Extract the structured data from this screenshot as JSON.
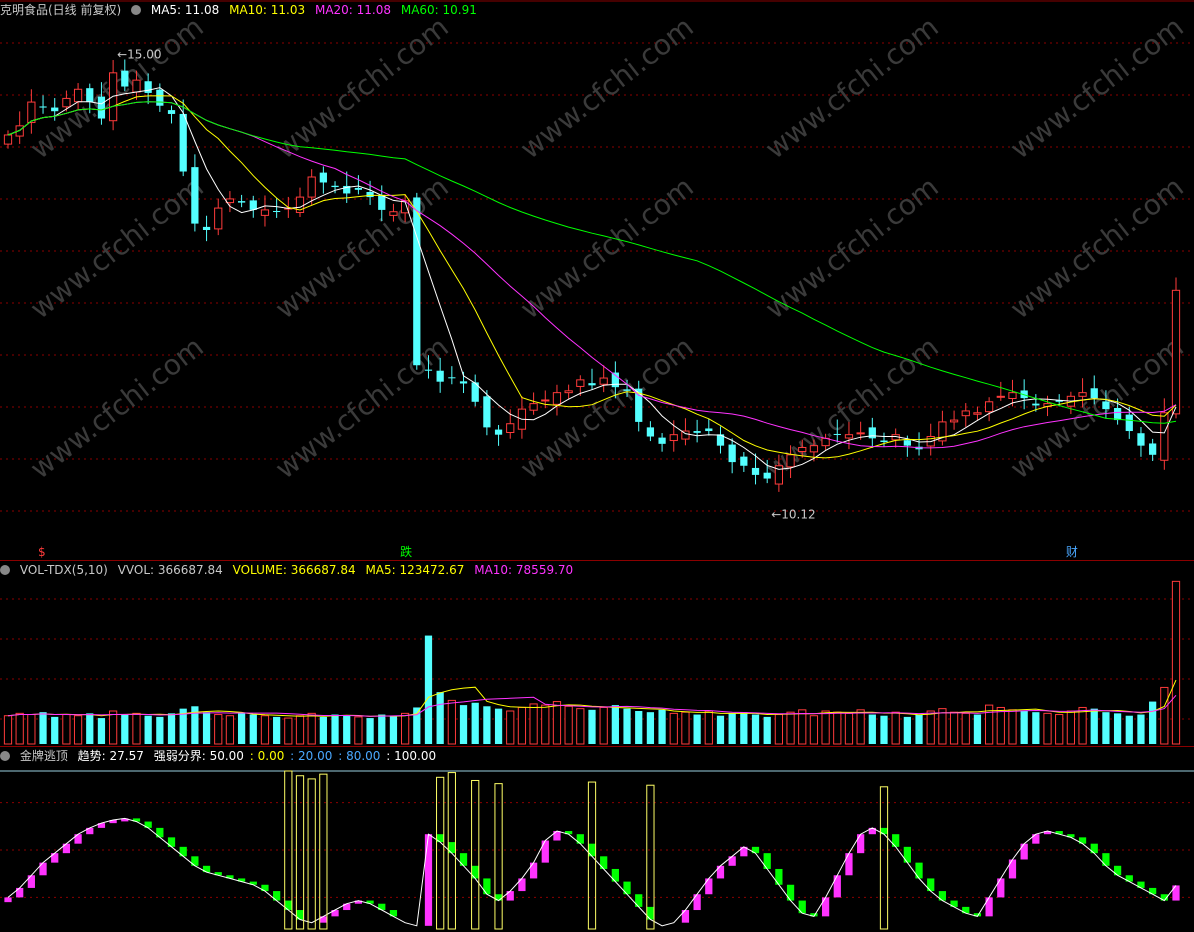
{
  "header": {
    "title": "克明食品(日线 前复权)",
    "ma_items": [
      {
        "label": "MA5: 11.08",
        "color": "#ffffff"
      },
      {
        "label": "MA10: 11.03",
        "color": "#ffff00"
      },
      {
        "label": "MA20: 11.08",
        "color": "#ff33ff"
      },
      {
        "label": "MA60: 10.91",
        "color": "#00ff00"
      }
    ]
  },
  "vol_header": {
    "title": "VOL-TDX(5,10)",
    "items": [
      {
        "label": "VVOL: 366687.84",
        "color": "#c8c8c8"
      },
      {
        "label": "VOLUME: 366687.84",
        "color": "#ffff00"
      },
      {
        "label": "MA5: 123472.67",
        "color": "#ffff00"
      },
      {
        "label": "MA10: 78559.70",
        "color": "#ff33ff"
      }
    ]
  },
  "ind_header": {
    "title": "金牌逃顶",
    "items": [
      {
        "label": "趋势: 27.57",
        "color": "#ffffff"
      },
      {
        "label": "强弱分界: 50.00",
        "color": "#ffffff"
      },
      {
        "label": ": 0.00",
        "color": "#ffff00"
      },
      {
        "label": ": 20.00",
        "color": "#4aa8ff"
      },
      {
        "label": ": 80.00",
        "color": "#4aa8ff"
      },
      {
        "label": ": 100.00",
        "color": "#ffffff"
      }
    ]
  },
  "watermark": "www.cfchi.com",
  "colors": {
    "up": "#ff3b3b",
    "down": "#54ffff",
    "ma5": "#ffffff",
    "ma10": "#ffff00",
    "ma20": "#ff33ff",
    "ma60": "#00ff00",
    "grid": "#8b0000",
    "ind_up": "#ff33ff",
    "ind_down": "#00ff00",
    "ind_bar": "#ffff66"
  },
  "chart_data": [
    {
      "type": "candlestick",
      "title": "克明食品(日线 前复权)",
      "ylim": [
        9.6,
        15.4
      ],
      "annotations": [
        {
          "text": "15.00",
          "kind": "high",
          "value": 15.0
        },
        {
          "text": "10.12",
          "kind": "low",
          "value": 10.12
        }
      ],
      "event_markers": [
        {
          "text": "$",
          "index": 3,
          "color": "#ff3b3b"
        },
        {
          "text": "跌",
          "index": 34,
          "color": "#00ff00"
        },
        {
          "text": "财",
          "index": 91,
          "color": "#4aa8ff"
        }
      ],
      "close": [
        14.12,
        14.22,
        14.48,
        14.42,
        14.38,
        14.52,
        14.62,
        14.48,
        14.3,
        14.8,
        14.65,
        14.72,
        14.58,
        14.44,
        14.35,
        13.72,
        13.15,
        13.08,
        13.32,
        13.42,
        13.38,
        13.3,
        13.3,
        13.28,
        13.32,
        13.44,
        13.66,
        13.6,
        13.55,
        13.48,
        13.52,
        13.44,
        13.3,
        13.28,
        13.4,
        11.6,
        11.54,
        11.42,
        11.46,
        11.4,
        11.2,
        10.92,
        10.84,
        10.96,
        11.12,
        11.18,
        11.22,
        11.3,
        11.32,
        11.44,
        11.38,
        11.46,
        11.36,
        11.32,
        10.98,
        10.82,
        10.74,
        10.84,
        10.88,
        10.86,
        10.88,
        10.72,
        10.54,
        10.5,
        10.4,
        10.36,
        10.5,
        10.62,
        10.7,
        10.72,
        10.8,
        10.84,
        10.84,
        10.86,
        10.8,
        10.76,
        10.84,
        10.72,
        10.68,
        10.82,
        10.98,
        11.0,
        11.1,
        11.08,
        11.2,
        11.26,
        11.3,
        11.24,
        11.16,
        11.18,
        11.2,
        11.26,
        11.3,
        11.24,
        11.12,
        11.0,
        10.88,
        10.72,
        10.62,
        11.08,
        12.42
      ],
      "volume": [
        24,
        26,
        25,
        27,
        23,
        25,
        24,
        26,
        22,
        28,
        25,
        26,
        24,
        23,
        26,
        30,
        32,
        27,
        25,
        24,
        26,
        25,
        24,
        23,
        22,
        24,
        26,
        23,
        25,
        24,
        23,
        22,
        25,
        24,
        26,
        31,
        92,
        44,
        37,
        33,
        35,
        32,
        30,
        28,
        31,
        34,
        33,
        36,
        32,
        30,
        29,
        31,
        33,
        30,
        28,
        27,
        29,
        26,
        27,
        25,
        28,
        24,
        26,
        27,
        25,
        23,
        25,
        27,
        29,
        24,
        28,
        27,
        26,
        29,
        25,
        24,
        27,
        23,
        25,
        28,
        30,
        27,
        26,
        25,
        33,
        31,
        29,
        28,
        27,
        26,
        25,
        28,
        31,
        30,
        27,
        26,
        24,
        25,
        36,
        48,
        138
      ],
      "volume_ylim": [
        0,
        140
      ]
    },
    {
      "type": "bar",
      "title": "金牌逃顶",
      "ylim": [
        0,
        100
      ],
      "trend": [
        20,
        26,
        34,
        42,
        48,
        54,
        60,
        64,
        67,
        69,
        70,
        68,
        64,
        58,
        52,
        46,
        40,
        36,
        34,
        32,
        30,
        28,
        24,
        18,
        12,
        6,
        4,
        8,
        12,
        16,
        18,
        16,
        12,
        8,
        4,
        2,
        60,
        55,
        48,
        40,
        32,
        22,
        18,
        24,
        32,
        42,
        56,
        62,
        60,
        54,
        46,
        38,
        30,
        22,
        14,
        6,
        2,
        4,
        12,
        22,
        32,
        40,
        46,
        52,
        48,
        38,
        28,
        18,
        10,
        8,
        20,
        34,
        48,
        60,
        64,
        60,
        52,
        42,
        32,
        24,
        18,
        14,
        10,
        8,
        20,
        32,
        44,
        54,
        60,
        62,
        60,
        58,
        54,
        48,
        40,
        34,
        30,
        26,
        22,
        18,
        27.57
      ],
      "tops": [
        100,
        97,
        95,
        98,
        96,
        99,
        94,
        92,
        93,
        91,
        90
      ]
    }
  ]
}
